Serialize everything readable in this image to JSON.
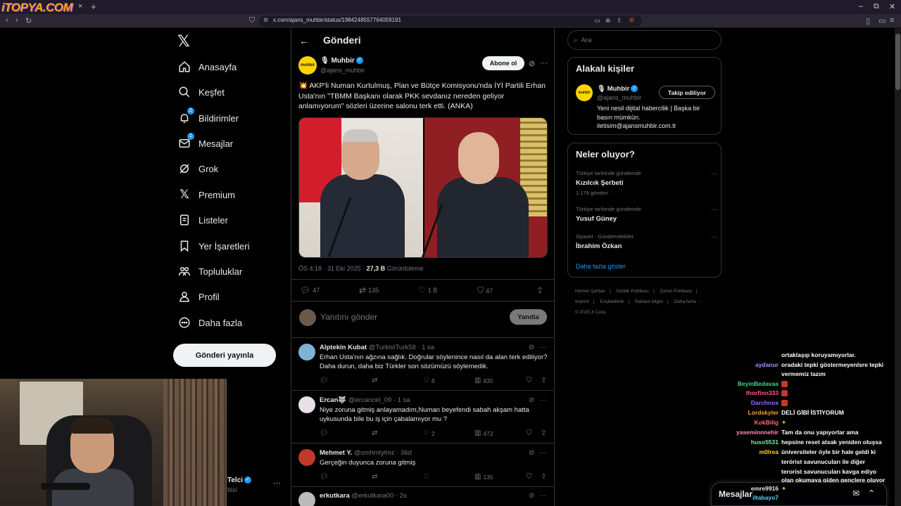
{
  "browser": {
    "logo_text": "iTOPYA.COM",
    "url": "x.com/ajans_muhbir/status/1984248557764059191",
    "close_tab": "×",
    "new_tab": "+",
    "minimize": "–",
    "restore": "⧉",
    "close": "✕"
  },
  "nav": {
    "items": [
      {
        "label": "Anasayfa",
        "icon": "home-icon"
      },
      {
        "label": "Keşfet",
        "icon": "search-icon"
      },
      {
        "label": "Bildirimler",
        "icon": "bell-icon",
        "badge": "2"
      },
      {
        "label": "Mesajlar",
        "icon": "mail-icon",
        "badge": "1"
      },
      {
        "label": "Grok",
        "icon": "grok-icon"
      },
      {
        "label": "Premium",
        "icon": "x-icon"
      },
      {
        "label": "Listeler",
        "icon": "list-icon"
      },
      {
        "label": "Yer İşaretleri",
        "icon": "bookmark-icon"
      },
      {
        "label": "Topluluklar",
        "icon": "communities-icon"
      },
      {
        "label": "Profil",
        "icon": "profile-icon"
      },
      {
        "label": "Daha fazla",
        "icon": "more-icon"
      }
    ],
    "post_button": "Gönderi yayınla",
    "account_name": "Telci",
    "account_handle": "bixi"
  },
  "main": {
    "title": "Gönderi",
    "post": {
      "author_name": "Muhbir",
      "author_handle": "@ajans_muhbir",
      "avatar_text": "muhbir",
      "subscribe_label": "Abone ol",
      "text": "💥 AKP'li Numan Kurtulmuş, Plan ve Bütçe Komisyonu'nda İYİ Partili Erhan Usta'nın \"TBMM Başkanı olarak PKK sevdanız nereden geliyor anlamıyorum\" sözleri üzerine salonu terk etti. (ANKA)",
      "time": "ÖS 4:18 · 31 Eki 2025 · ",
      "views": "27,3 B",
      "views_label": " Görüntüleme",
      "replies": "47",
      "reposts": "135",
      "likes": "1 B",
      "bookmarks": "47"
    },
    "reply_box": {
      "placeholder": "Yanıtını gönder",
      "button": "Yanıtla"
    },
    "replies": [
      {
        "name": "Alptekin Kubat",
        "handle": "@TurkistTurk58",
        "time": "· 1 sa",
        "text": "Erhan Usta'nın ağzına sağlık. Doğrular söylenince nasıl da alan terk ediliyor? Daha durun, daha biz Türkler son sözümüzü söylemedik.",
        "likes": "8",
        "views": "835",
        "avatar_color": "#7fb3d5"
      },
      {
        "name": "Ercan🐺",
        "handle": "@ercancel_09",
        "time": "· 1 sa",
        "text": "Niye zoruna gitmiş anlayamadım,Numan beyefendi sabah akşam hatta uykusunda bile bu iş için çabalamıyor mu ?",
        "likes": "2",
        "views": "472",
        "avatar_color": "#e8e0e6"
      },
      {
        "name": "Mehmet Y.",
        "handle": "@smhmtylmz",
        "time": "· 36d",
        "text": "Gerçeğin duyunca zoruna gitmiş",
        "likes": "",
        "views": "135",
        "avatar_color": "#c0392b"
      },
      {
        "name": "erkutkara",
        "handle": "@erkutkara00",
        "time": "· 2s",
        "text": "",
        "likes": "",
        "views": "",
        "avatar_color": "#bbbbbb"
      }
    ]
  },
  "sidebar": {
    "search_placeholder": "Ara",
    "related_title": "Alakalı kişiler",
    "related": {
      "name": "Muhbir",
      "handle": "@ajans_muhbir",
      "button": "Takip ediliyor",
      "bio": "Yeni nesil dijital habercilik | Başka bir basın mümkün. iletisim@ajansmuhbir.com.tr"
    },
    "trends_title": "Neler oluyor?",
    "trends": [
      {
        "context": "Türkiye tarihinde gündemde",
        "name": "Kızılcık Şerbeti",
        "count": "1.179 gönderi"
      },
      {
        "context": "Türkiye tarihinde gündemde",
        "name": "Yusuf Güney",
        "count": ""
      },
      {
        "context": "Siyaset · Gündemdekiler",
        "name": "İbrahim Özkan",
        "count": ""
      }
    ],
    "show_more": "Daha fazla göster",
    "footer": [
      "Hizmet Şartları",
      "Gizlilik Politikası",
      "Çerez Politikası",
      "Imprint",
      "Erişilebilirlik",
      "Reklam bilgisi",
      "Daha fazla ···",
      "© 2025 X Corp."
    ]
  },
  "chat": [
    {
      "user": "",
      "color": "#ffffff",
      "msg": "ortaklaşıp koruyamıyorlar."
    },
    {
      "user": "aydanur",
      "color": "#b28cff",
      "msg": "oradaki tepki göstermeyenlsre tepki"
    },
    {
      "user": "",
      "color": "#ffffff",
      "msg": "vermemiz lazım"
    },
    {
      "user": "BeyinBedavaa",
      "color": "#3ddc84",
      "msg": ""
    },
    {
      "user": "thorfinn333",
      "color": "#ff5c8a",
      "msg": ""
    },
    {
      "user": "Darchnox",
      "color": "#9b6bff",
      "msg": ""
    },
    {
      "user": "Lordskyler",
      "color": "#ff9f43",
      "msg": "DELİ GİBİ İSTİYORUM"
    },
    {
      "user": "KokBilig",
      "color": "#ff6b6b",
      "msg": ""
    },
    {
      "user": "yaseminnnehir",
      "color": "#ff8fb3",
      "msg": "Tam da onu yapıyorlar ama"
    },
    {
      "user": "huso5531",
      "color": "#7bed9f",
      "msg": "hepsine reset atsak yeniden oluşsa"
    },
    {
      "user": "m0lrea",
      "color": "#ffd32a",
      "msg": "üniversiteler öyle bir hale geldi ki"
    },
    {
      "user": "",
      "color": "#ffffff",
      "msg": "terörist savunucuları ile diğer"
    },
    {
      "user": "",
      "color": "#ffffff",
      "msg": "terorist savunucuları kavga ediyo"
    },
    {
      "user": "",
      "color": "#ffffff",
      "msg": "olan okumaya giden gençlere oluyor"
    },
    {
      "user": "emre9916",
      "color": "#ffffff",
      "msg": ""
    },
    {
      "user": "iltabayo7",
      "color": "#48dbfb",
      "msg": ""
    }
  ],
  "messages_bar": {
    "label": "Mesajlar"
  }
}
